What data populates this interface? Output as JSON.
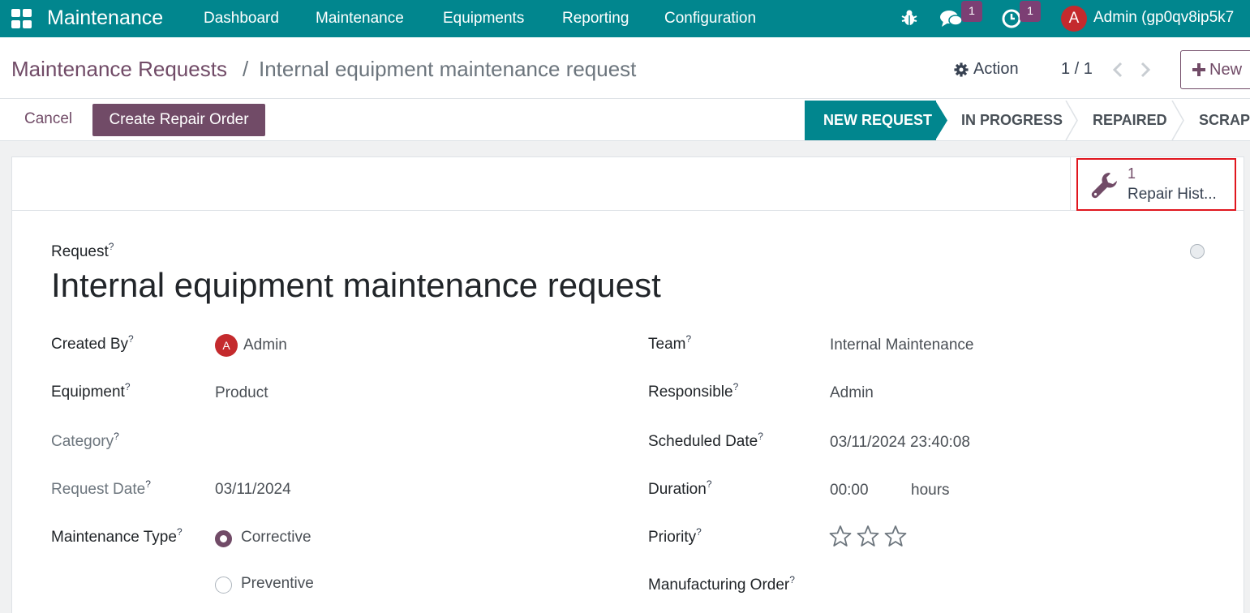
{
  "navbar": {
    "brand": "Maintenance",
    "menu": [
      "Dashboard",
      "Maintenance",
      "Equipments",
      "Reporting",
      "Configuration"
    ],
    "messages_count": "1",
    "activities_count": "1",
    "user_initial": "A",
    "user_name": "Admin (gp0qv8ip5k7"
  },
  "control": {
    "breadcrumb_root": "Maintenance Requests",
    "breadcrumb_sep": "/",
    "breadcrumb_current": "Internal equipment maintenance request",
    "action_label": "Action",
    "pager": "1 / 1",
    "new_label": "New"
  },
  "statusbar": {
    "cancel_label": "Cancel",
    "create_repair_label": "Create Repair Order",
    "stages": [
      "NEW REQUEST",
      "IN PROGRESS",
      "REPAIRED",
      "SCRAP"
    ],
    "active_stage": "NEW REQUEST"
  },
  "smart_button": {
    "count": "1",
    "label": "Repair Hist..."
  },
  "form": {
    "request_label": "Request",
    "title": "Internal equipment maintenance request",
    "left": {
      "created_by_label": "Created By",
      "created_by_initial": "A",
      "created_by_value": "Admin",
      "equipment_label": "Equipment",
      "equipment_value": "Product",
      "category_label": "Category",
      "request_date_label": "Request Date",
      "request_date_value": "03/11/2024",
      "maintenance_type_label": "Maintenance Type",
      "maintenance_type_options": [
        "Corrective",
        "Preventive"
      ],
      "maintenance_type_selected": "Corrective"
    },
    "right": {
      "team_label": "Team",
      "team_value": "Internal Maintenance",
      "responsible_label": "Responsible",
      "responsible_value": "Admin",
      "scheduled_date_label": "Scheduled Date",
      "scheduled_date_value": "03/11/2024 23:40:08",
      "duration_label": "Duration",
      "duration_value": "00:00",
      "duration_unit": "hours",
      "priority_label": "Priority",
      "priority_value": 0,
      "priority_max": 3,
      "manufacturing_order_label": "Manufacturing Order"
    },
    "help_mark": "?"
  },
  "colors": {
    "navbar": "#01868e",
    "primary": "#714b67",
    "highlight": "#e0161e",
    "avatar": "#c42a2d"
  }
}
